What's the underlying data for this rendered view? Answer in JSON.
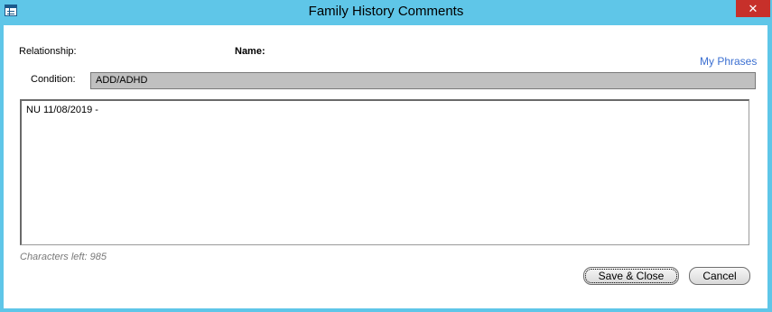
{
  "window": {
    "title": "Family History Comments",
    "close_glyph": "✕",
    "icon": "table-icon"
  },
  "form": {
    "relationship_label": "Relationship:",
    "name_label": "Name:",
    "my_phrases_link": "My Phrases",
    "condition_label": "Condition:",
    "condition_value": "ADD/ADHD",
    "comment_text": "NU 11/08/2019 -",
    "chars_left": "Characters left: 985"
  },
  "buttons": {
    "save_close": "Save & Close",
    "cancel": "Cancel"
  },
  "colors": {
    "titlebar": "#5fc6e8",
    "close": "#c7302a",
    "link": "#3b6fd1",
    "field_bg": "#c0c0c0"
  }
}
